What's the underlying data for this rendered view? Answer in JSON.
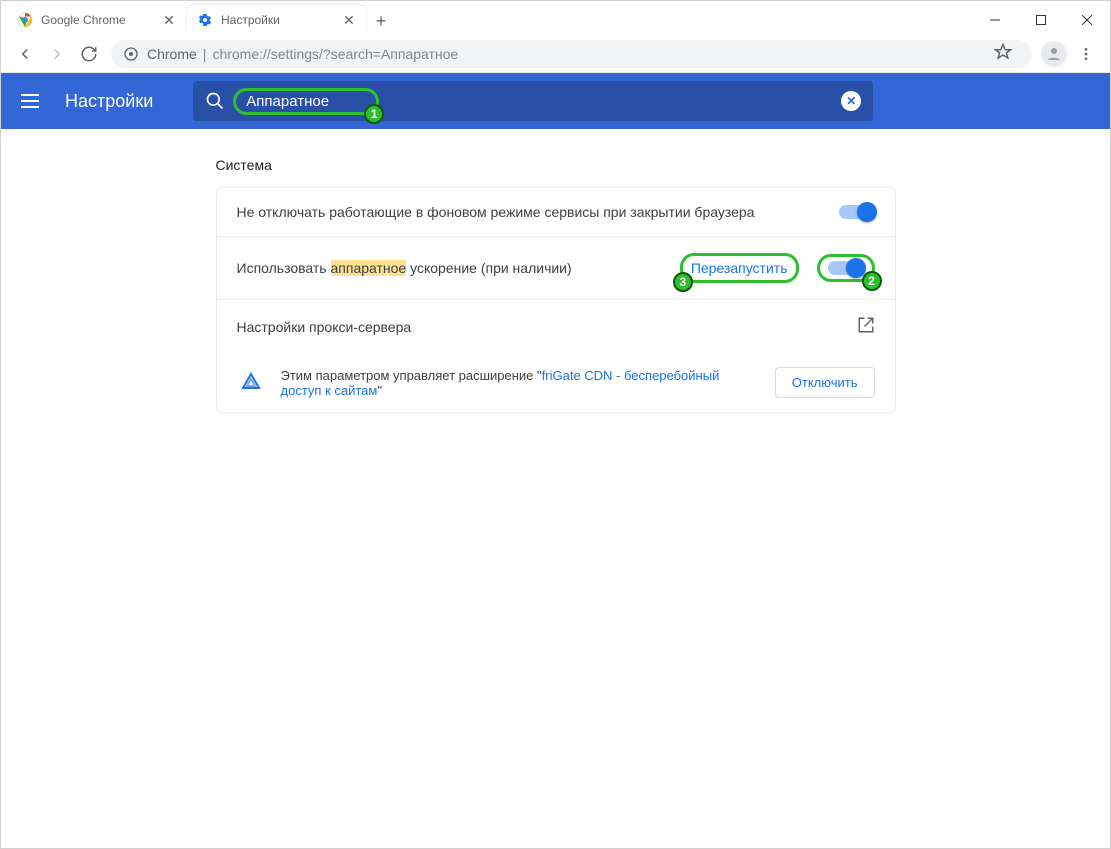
{
  "window": {
    "tabs": [
      {
        "title": "Google Chrome",
        "active": false
      },
      {
        "title": "Настройки",
        "active": true
      }
    ]
  },
  "omnibox": {
    "host_label": "Chrome",
    "url_path": "chrome://settings/?search=Аппаратное"
  },
  "settings": {
    "title": "Настройки",
    "search_value": "Аппаратное",
    "section_title": "Система",
    "row1": "Не отключать работающие в фоновом режиме сервисы при закрытии браузера",
    "row2_pre": "Использовать ",
    "row2_highlight": "аппаратное",
    "row2_post": " ускорение (при наличии)",
    "restart": "Перезапустить",
    "proxy": "Настройки прокси-сервера",
    "ext_pre": "Этим параметром управляет расширение \"",
    "ext_link": "friGate CDN - бесперебойный доступ к сайтам",
    "ext_post": "\"",
    "disable": "Отключить"
  },
  "badges": {
    "b1": "1",
    "b2": "2",
    "b3": "3"
  }
}
